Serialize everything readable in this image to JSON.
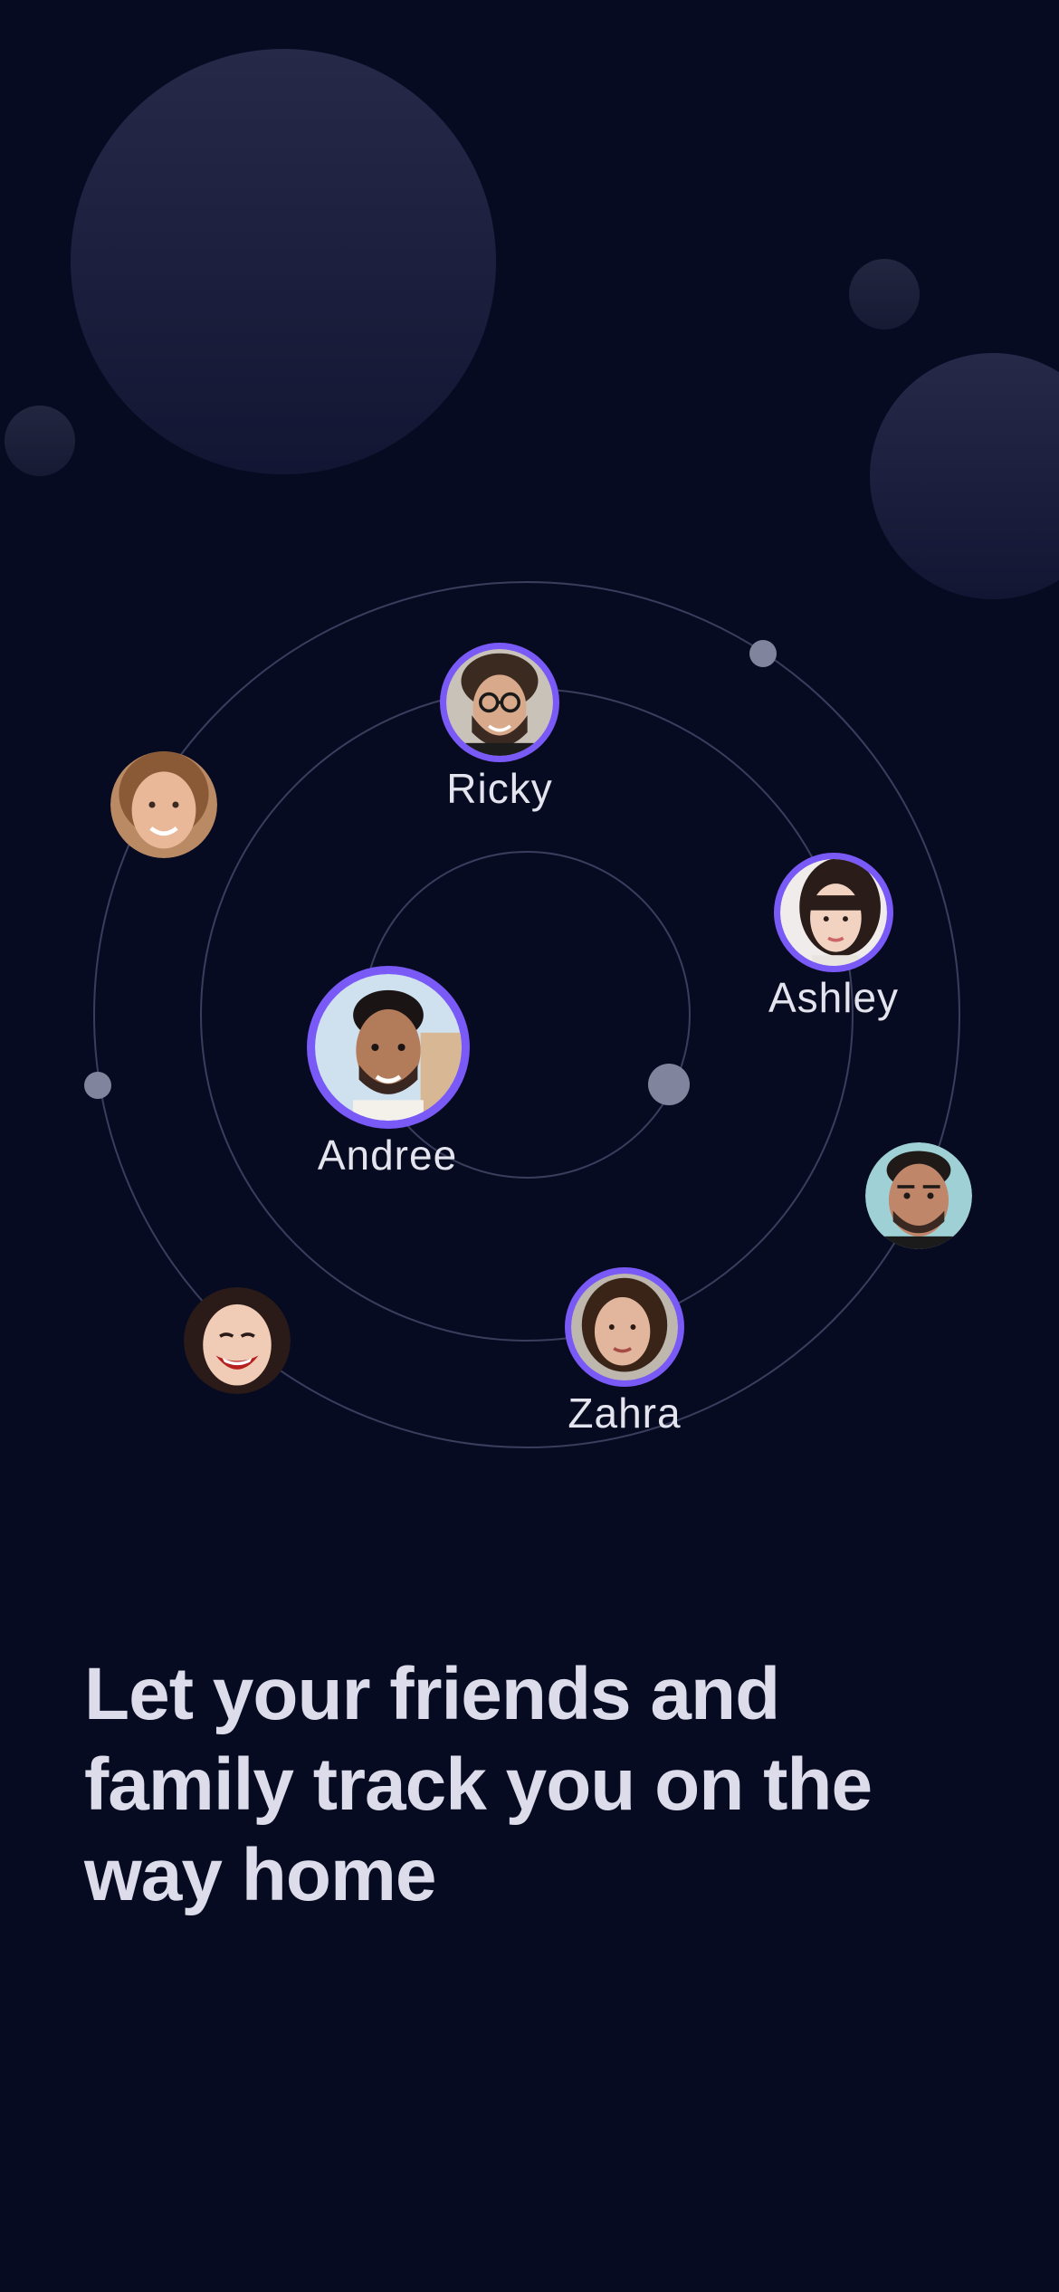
{
  "headline": {
    "lines": [
      "Let your friends and",
      "family track you on the",
      "way home"
    ]
  },
  "people": {
    "ricky": {
      "name": "Ricky"
    },
    "ashley": {
      "name": "Ashley"
    },
    "andree": {
      "name": "Andree"
    },
    "zahra": {
      "name": "Zahra"
    }
  },
  "colors": {
    "background": "#070b22",
    "accent_ring": "#7a5af6",
    "orbit_line": "#3a3e5c",
    "dot": "#80849c"
  }
}
